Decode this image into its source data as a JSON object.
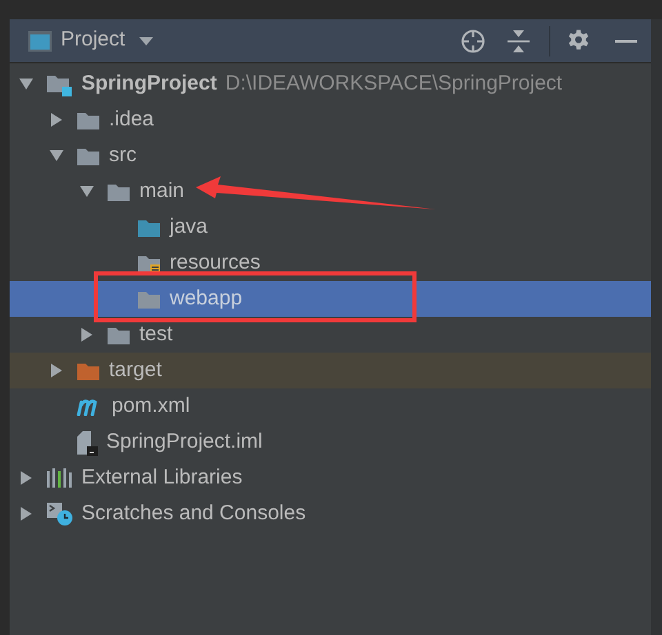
{
  "toolbar": {
    "title": "Project"
  },
  "tree": [
    {
      "label": "SpringProject",
      "path": "D:\\IDEAWORKSPACE\\SpringProject",
      "kind": "module",
      "expanded": true,
      "selected": false,
      "children": [
        {
          "label": ".idea",
          "kind": "folder",
          "expanded": false,
          "selected": false
        },
        {
          "label": "src",
          "kind": "folder",
          "expanded": true,
          "selected": false,
          "children": [
            {
              "label": "main",
              "kind": "folder",
              "expanded": true,
              "selected": false,
              "children": [
                {
                  "label": "java",
                  "kind": "source_folder",
                  "selected": false
                },
                {
                  "label": "resources",
                  "kind": "resources_folder",
                  "selected": false
                },
                {
                  "label": "webapp",
                  "kind": "folder",
                  "selected": true
                }
              ]
            },
            {
              "label": "test",
              "kind": "folder",
              "expanded": false,
              "selected": false
            }
          ]
        },
        {
          "label": "target",
          "kind": "excluded_folder",
          "expanded": false,
          "selected": false
        },
        {
          "label": "pom.xml",
          "kind": "maven",
          "selected": false
        },
        {
          "label": "SpringProject.iml",
          "kind": "iml",
          "selected": false
        }
      ]
    },
    {
      "label": "External Libraries",
      "kind": "libraries",
      "expanded": false,
      "selected": false
    },
    {
      "label": "Scratches and Consoles",
      "kind": "scratches",
      "expanded": false,
      "selected": false
    }
  ],
  "annotations": {
    "arrow": true,
    "highlight_box": true
  }
}
